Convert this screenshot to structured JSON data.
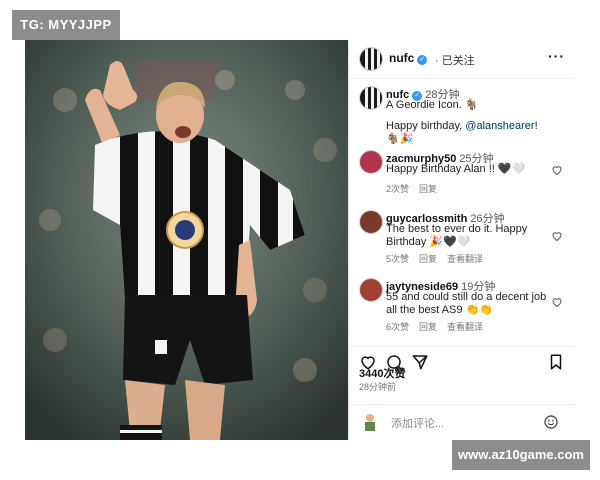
{
  "watermark_top": "TG: MYYJJPP",
  "watermark_bottom": "www.az10game.com",
  "post": {
    "username": "nufc",
    "follow_status": "· 已关注",
    "more_icon": "more-dots-icon"
  },
  "comments": [
    {
      "username": "nufc",
      "time": "28分钟",
      "text_line1": "A Geordie Icon. 🐐",
      "text_line2_prefix": "Happy birthday, ",
      "mention": "@alanshearer",
      "text_line2_suffix": "! 🐐🎉",
      "is_caption": true
    },
    {
      "username": "zacmurphy50",
      "time": "25分钟",
      "text": "Happy Birthday Alan !! 🖤🤍",
      "likes": "2次赞",
      "reply": "回复"
    },
    {
      "username": "guycarlossmith",
      "time": "26分钟",
      "text": "The best to ever do it. Happy Birthday 🎉🖤🤍",
      "likes": "5次赞",
      "reply": "回复",
      "translate": "查看翻译"
    },
    {
      "username": "jaytyneside69",
      "time": "19分钟",
      "text": "55 and could still do a decent job all the best AS9 👏👏",
      "likes": "6次赞",
      "reply": "回复",
      "translate": "查看翻译"
    }
  ],
  "likes_count": "3440次赞",
  "post_time": "28分钟前",
  "add_comment_placeholder": "添加评论...",
  "colors": {
    "verified": "#3897f0",
    "mention": "#00376b",
    "watermark_bg": "#8c8c8c"
  }
}
